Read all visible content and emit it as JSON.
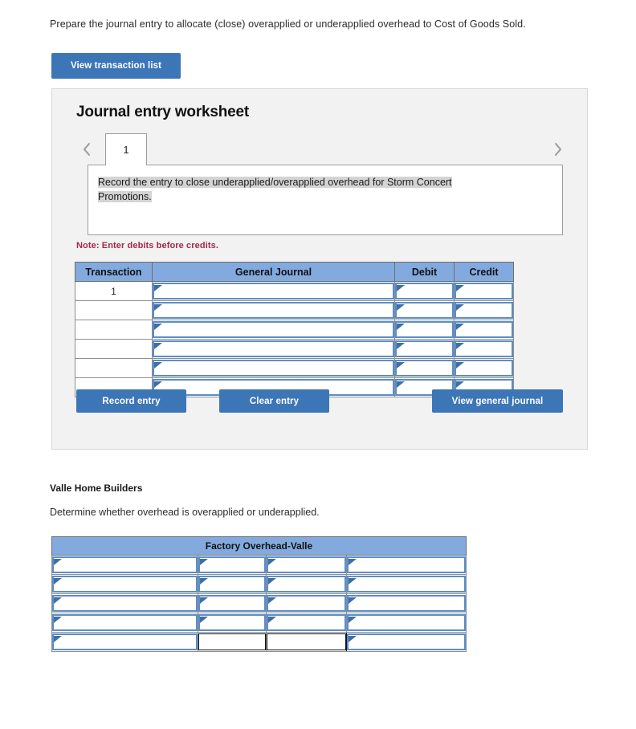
{
  "prompt": "Prepare the journal entry to allocate (close) overapplied or underapplied overhead to Cost of Goods Sold.",
  "view_transaction_list_label": "View transaction list",
  "worksheet": {
    "title": "Journal entry worksheet",
    "prev_icon": "chevron-left-icon",
    "next_icon": "chevron-right-icon",
    "tabs": [
      {
        "label": "1",
        "selected": true
      }
    ],
    "instruction": "Record the entry to close underapplied/overapplied overhead for Storm Concert Promotions.",
    "note": "Note: Enter debits before credits.",
    "table": {
      "headers": [
        "Transaction",
        "General Journal",
        "Debit",
        "Credit"
      ],
      "rows": [
        {
          "transaction": "1",
          "general_journal": "",
          "debit": "",
          "credit": ""
        },
        {
          "transaction": "",
          "general_journal": "",
          "debit": "",
          "credit": ""
        },
        {
          "transaction": "",
          "general_journal": "",
          "debit": "",
          "credit": ""
        },
        {
          "transaction": "",
          "general_journal": "",
          "debit": "",
          "credit": ""
        },
        {
          "transaction": "",
          "general_journal": "",
          "debit": "",
          "credit": ""
        },
        {
          "transaction": "",
          "general_journal": "",
          "debit": "",
          "credit": ""
        }
      ]
    },
    "buttons": {
      "record_entry": "Record entry",
      "clear_entry": "Clear entry",
      "view_general_journal": "View general journal"
    }
  },
  "lower": {
    "company_name": "Valle Home Builders",
    "sub_prompt": "Determine whether overhead is overapplied or underapplied.",
    "t_account": {
      "header": "Factory Overhead-Valle",
      "rows": [
        {
          "c1": "",
          "c2": "",
          "c3": "",
          "c4": "",
          "total": false
        },
        {
          "c1": "",
          "c2": "",
          "c3": "",
          "c4": "",
          "total": false
        },
        {
          "c1": "",
          "c2": "",
          "c3": "",
          "c4": "",
          "total": false
        },
        {
          "c1": "",
          "c2": "",
          "c3": "",
          "c4": "",
          "total": false
        },
        {
          "c1": "",
          "c2": "",
          "c3": "",
          "c4": "",
          "total": true
        }
      ]
    }
  },
  "colors": {
    "button_blue": "#3d76b6",
    "header_blue": "#82aadf",
    "input_border_blue": "#5b8dc8",
    "note_red": "#a02a4c",
    "panel_bg": "#f2f2f2",
    "highlight_gray": "#d4d4d4"
  }
}
